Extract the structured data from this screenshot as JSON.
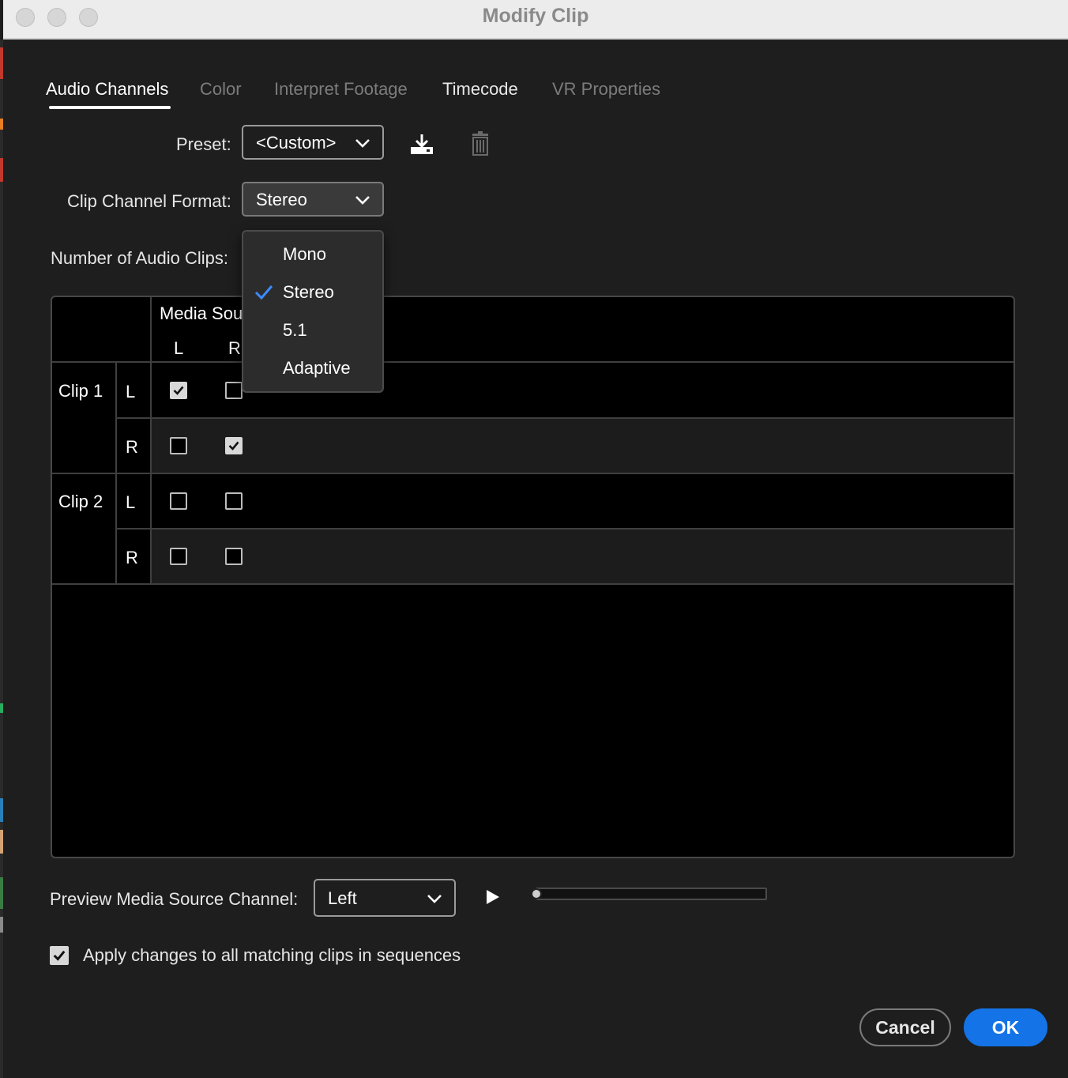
{
  "window": {
    "title": "Modify Clip"
  },
  "tabs": [
    {
      "label": "Audio Channels",
      "active": true
    },
    {
      "label": "Color",
      "active": false
    },
    {
      "label": "Interpret Footage",
      "active": false
    },
    {
      "label": "Timecode",
      "active": false
    },
    {
      "label": "VR Properties",
      "active": false
    }
  ],
  "preset": {
    "label": "Preset:",
    "value": "<Custom>",
    "save_icon": "download-icon",
    "delete_icon": "trash-icon"
  },
  "channel_format": {
    "label": "Clip Channel Format:",
    "value": "Stereo",
    "options": [
      "Mono",
      "Stereo",
      "5.1",
      "Adaptive"
    ],
    "selected": "Stereo"
  },
  "audio_clips": {
    "label": "Number of Audio Clips:"
  },
  "table": {
    "header": "Media Sou",
    "columns": [
      "L",
      "R"
    ],
    "clips": [
      {
        "name": "Clip 1",
        "rows": [
          {
            "channel": "L",
            "checks": [
              true,
              false
            ]
          },
          {
            "channel": "R",
            "checks": [
              false,
              true
            ]
          }
        ]
      },
      {
        "name": "Clip 2",
        "rows": [
          {
            "channel": "L",
            "checks": [
              false,
              false
            ]
          },
          {
            "channel": "R",
            "checks": [
              false,
              false
            ]
          }
        ]
      }
    ]
  },
  "preview": {
    "label": "Preview Media Source Channel:",
    "value": "Left",
    "play_icon": "play-icon",
    "position": 0
  },
  "apply_all": {
    "label": "Apply changes to all matching clips in sequences",
    "checked": true
  },
  "buttons": {
    "cancel": "Cancel",
    "ok": "OK"
  },
  "colors": {
    "accent": "#1473e6",
    "check_blue": "#3d8bff",
    "background": "#1e1e1e"
  }
}
